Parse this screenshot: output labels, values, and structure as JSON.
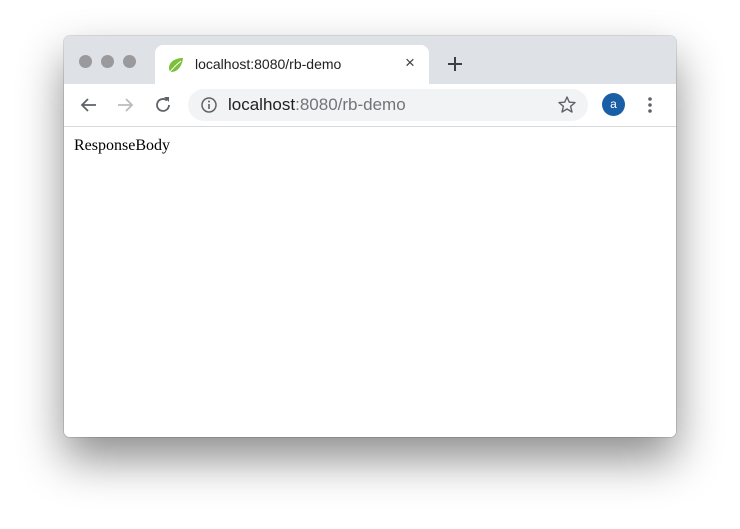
{
  "window": {
    "traffic_lights": [
      "close",
      "minimize",
      "zoom"
    ]
  },
  "tab": {
    "title": "localhost:8080/rb-demo",
    "favicon": "spring-leaf-icon",
    "close_label": "×"
  },
  "toolbar": {
    "back_icon": "arrow-left-icon",
    "forward_icon": "arrow-right-icon",
    "reload_icon": "reload-icon",
    "menu_icon": "vertical-dots-icon"
  },
  "omnibox": {
    "info_icon": "info-icon",
    "url_host": "localhost",
    "url_rest": ":8080/rb-demo",
    "bookmark_icon": "star-icon"
  },
  "profile": {
    "initial": "a",
    "color": "#1a5fa6"
  },
  "page": {
    "body_text": "ResponseBody"
  },
  "colors": {
    "tabstrip": "#dee1e6",
    "traffic_light": "#9a9a9d",
    "favicon": "#6db33f"
  }
}
